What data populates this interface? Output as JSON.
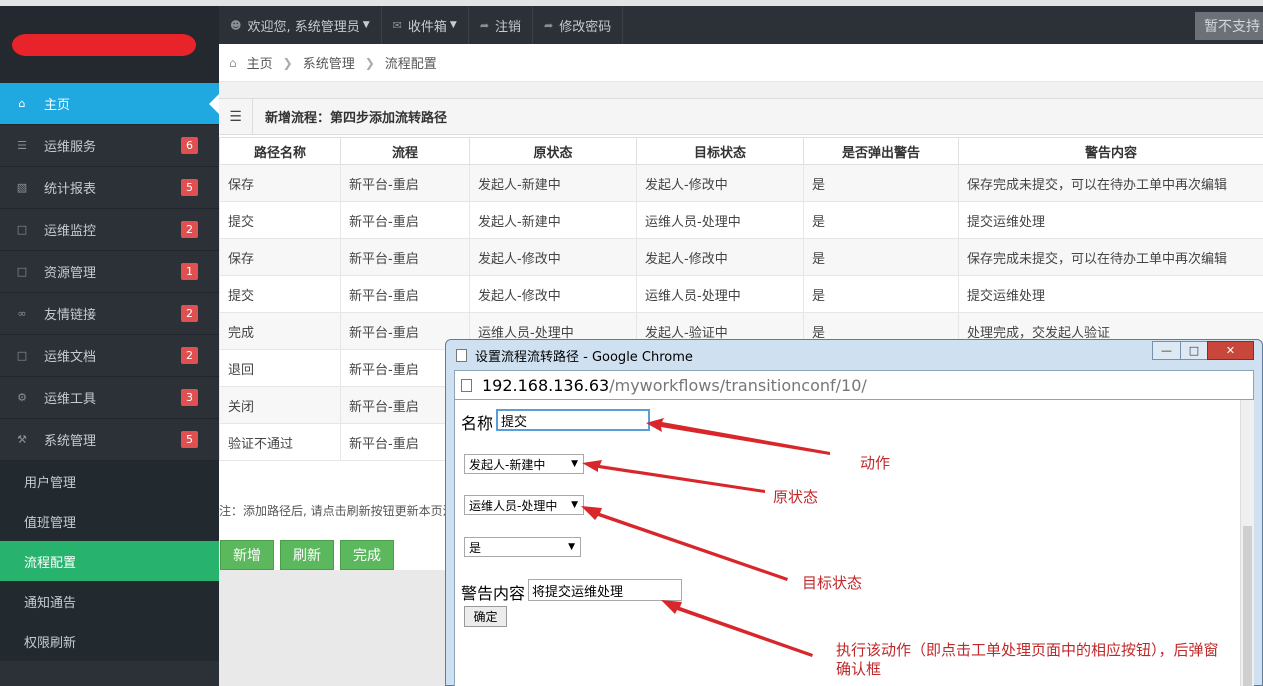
{
  "topnav": {
    "welcome": "欢迎您, 系统管理员",
    "inbox": "收件箱",
    "logout": "注销",
    "change_password": "修改密码",
    "unsupported": "暂不支持"
  },
  "breadcrumb": {
    "home": "主页",
    "level1": "系统管理",
    "level2": "流程配置"
  },
  "sidebar": {
    "items": [
      {
        "label": "主页",
        "icon": "home-icon"
      },
      {
        "label": "运维服务",
        "badge": "6",
        "icon": "list-icon"
      },
      {
        "label": "统计报表",
        "badge": "5",
        "icon": "bar-chart-icon"
      },
      {
        "label": "运维监控",
        "badge": "2",
        "icon": "file-icon"
      },
      {
        "label": "资源管理",
        "badge": "1",
        "icon": "file-icon"
      },
      {
        "label": "友情链接",
        "badge": "2",
        "icon": "link-icon"
      },
      {
        "label": "运维文档",
        "badge": "2",
        "icon": "file-icon"
      },
      {
        "label": "运维工具",
        "badge": "3",
        "icon": "cogs-icon"
      },
      {
        "label": "系统管理",
        "badge": "5",
        "icon": "wrench-icon"
      }
    ],
    "sub_items": [
      "用户管理",
      "值班管理",
      "流程配置",
      "通知通告",
      "权限刷新"
    ]
  },
  "panel": {
    "title": "新增流程：第四步添加流转路径"
  },
  "table": {
    "headers": [
      "路径名称",
      "流程",
      "原状态",
      "目标状态",
      "是否弹出警告",
      "警告内容"
    ],
    "rows": [
      [
        "保存",
        "新平台-重启",
        "发起人-新建中",
        "发起人-修改中",
        "是",
        "保存完成未提交，可以在待办工单中再次编辑"
      ],
      [
        "提交",
        "新平台-重启",
        "发起人-新建中",
        "运维人员-处理中",
        "是",
        "提交运维处理"
      ],
      [
        "保存",
        "新平台-重启",
        "发起人-修改中",
        "发起人-修改中",
        "是",
        "保存完成未提交，可以在待办工单中再次编辑"
      ],
      [
        "提交",
        "新平台-重启",
        "发起人-修改中",
        "运维人员-处理中",
        "是",
        "提交运维处理"
      ],
      [
        "完成",
        "新平台-重启",
        "运维人员-处理中",
        "发起人-验证中",
        "是",
        "处理完成，交发起人验证"
      ],
      [
        "退回",
        "新平台-重启",
        "",
        "",
        "",
        ""
      ],
      [
        "关闭",
        "新平台-重启",
        "",
        "",
        "",
        ""
      ],
      [
        "验证不通过",
        "新平台-重启",
        "",
        "",
        "",
        ""
      ]
    ]
  },
  "note": "注：添加路径后, 请点击刷新按钮更新本页流",
  "buttons": {
    "add": "新增",
    "refresh": "刷新",
    "done": "完成"
  },
  "popup": {
    "title": "设置流程流转路径 - Google Chrome",
    "url_host": "192.168.136.63",
    "url_path": "/myworkflows/transitionconf/10/",
    "name_label": "名称",
    "name_value": "提交",
    "from_state": "发起人-新建中",
    "to_state": "运维人员-处理中",
    "warn_flag": "是",
    "warn_label": "警告内容",
    "warn_value": "将提交运维处理",
    "confirm": "确定"
  },
  "annotations": {
    "action": "动作",
    "from_state": "原状态",
    "to_state": "目标状态",
    "warning_line1": "执行该动作（即点击工单处理页面中的相应按钮），后弹窗",
    "warning_line2": "确认框"
  },
  "colors": {
    "sidebar": "#2b3137",
    "active": "#1fa9e0",
    "sub_active": "#27b36d",
    "badge": "#e05050",
    "button": "#5cb85c",
    "annotation": "#c0282a"
  }
}
